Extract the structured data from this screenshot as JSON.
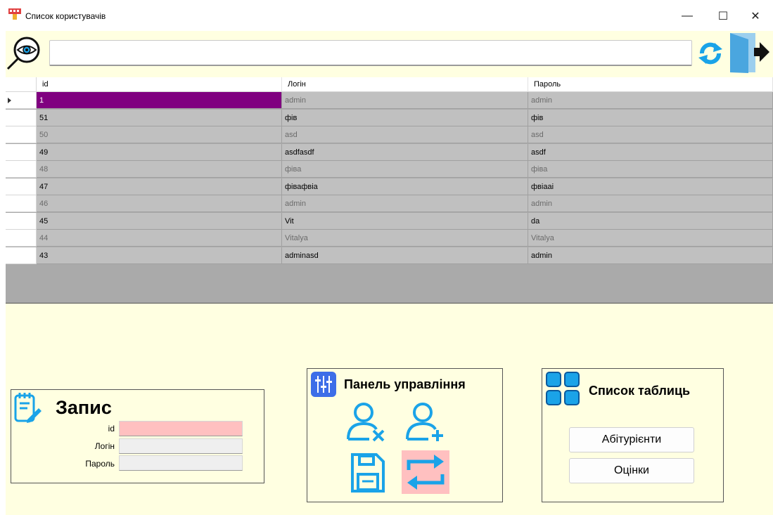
{
  "window": {
    "title": "Список користувачів",
    "controls": {
      "minimize": "—",
      "maximize": "☐",
      "close": "✕"
    }
  },
  "search": {
    "value": "",
    "placeholder": ""
  },
  "icons": {
    "app": "app-icon",
    "search": "magnifier-eye-icon",
    "refresh": "refresh-icon",
    "exit": "exit-door-icon",
    "record": "edit-note-icon",
    "control_panel": "sliders-icon",
    "delete_user": "user-remove-icon",
    "add_user": "user-add-icon",
    "save": "save-disk-icon",
    "swap": "swap-arrows-icon",
    "tables": "grid-tiles-icon"
  },
  "grid": {
    "columns": [
      "id",
      "Логін",
      "Пароль"
    ],
    "rows": [
      {
        "id": "1",
        "login": "admin",
        "password": "admin"
      },
      {
        "id": "51",
        "login": "фів",
        "password": "фів"
      },
      {
        "id": "50",
        "login": "asd",
        "password": "asd"
      },
      {
        "id": "49",
        "login": "asdfasdf",
        "password": "asdf"
      },
      {
        "id": "48",
        "login": "фіва",
        "password": "фіва"
      },
      {
        "id": "47",
        "login": "фівафвіа",
        "password": "фвіааі"
      },
      {
        "id": "46",
        "login": "admin",
        "password": "admin"
      },
      {
        "id": "45",
        "login": "Vit",
        "password": "da"
      },
      {
        "id": "44",
        "login": "Vitalya",
        "password": "Vitalya"
      },
      {
        "id": "43",
        "login": "adminasd",
        "password": "admin"
      }
    ],
    "selected_row": 0
  },
  "record": {
    "title": "Запис",
    "id_label": "id",
    "login_label": "Логін",
    "password_label": "Пароль",
    "id_value": "",
    "login_value": "",
    "password_value": ""
  },
  "control_panel": {
    "title": "Панель управління"
  },
  "tables": {
    "title": "Список таблиць",
    "applicants_button": "Абітурієнти",
    "grades_button": "Оцінки"
  },
  "colors": {
    "background": "#ffffe1",
    "selection": "#800080",
    "cell": "#c0c0c0",
    "grid_empty": "#aaaaaa",
    "accent_blue": "#1aa3e8",
    "highlight_pink": "#ffc0c0"
  }
}
